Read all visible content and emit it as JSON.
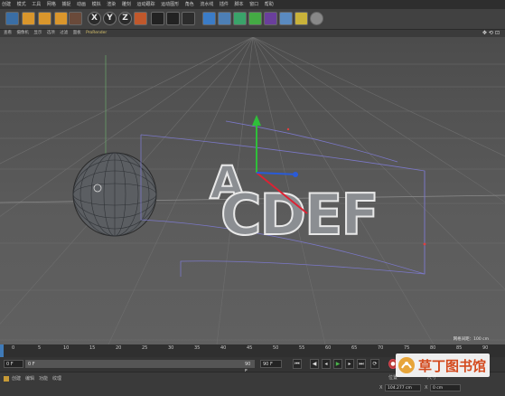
{
  "menubar": {
    "items": [
      "创建",
      "模式",
      "工具",
      "网格",
      "捕捉",
      "动画",
      "模拟",
      "渲染",
      "雕刻",
      "运动跟踪",
      "运动图形",
      "角色",
      "流水线",
      "插件",
      "脚本",
      "窗口",
      "帮助"
    ]
  },
  "toolbar": {
    "axis_x": "X",
    "axis_y": "Y",
    "axis_z": "Z"
  },
  "viewmenu": {
    "items": [
      "查看",
      "摄像机",
      "显示",
      "选项",
      "过滤",
      "面板"
    ],
    "prorender": "ProRender"
  },
  "viewport": {
    "letters": "CDEF",
    "partial_letter": "A",
    "status_label": "网格间距：100 cm"
  },
  "timeline": {
    "ticks": [
      "0",
      "5",
      "10",
      "15",
      "20",
      "25",
      "30",
      "35",
      "40",
      "45",
      "50",
      "55",
      "60",
      "65",
      "70",
      "75",
      "80",
      "85",
      "90"
    ]
  },
  "transport": {
    "start_frame": "0 F",
    "end_frame": "90 F",
    "current": "0 F",
    "end_field": "90 F"
  },
  "bottom": {
    "tabs": [
      "创建",
      "编辑",
      "功能",
      "纹理"
    ],
    "right_tabs": [
      "位置",
      "尺寸"
    ],
    "pos_x_label": "X",
    "pos_x_value": "104.277 cm",
    "size_label": "X",
    "size_value": "0 cm"
  },
  "watermark": {
    "text": "草丁图书馆"
  },
  "colors": {
    "accent_blue": "#3f7ab8",
    "record_red": "#b93b35",
    "play_green": "#4ab34a",
    "prorender_gold": "#d9c36c"
  }
}
